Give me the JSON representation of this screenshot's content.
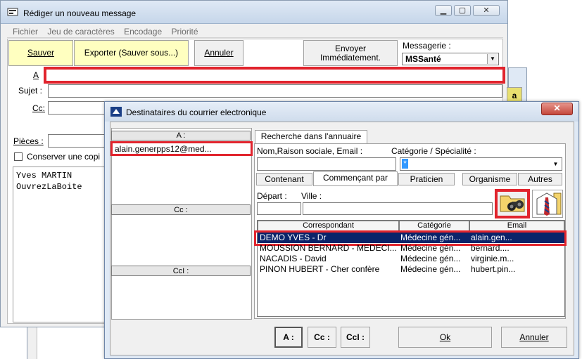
{
  "compose": {
    "title": "Rédiger un nouveau message",
    "menu": [
      "Fichier",
      "Jeu de caractères",
      "Encodage",
      "Priorité"
    ],
    "toolbar": {
      "save": "Sauver",
      "export": "Exporter (Sauver sous...)",
      "cancel": "Annuler",
      "send_line1": "Envoyer",
      "send_line2": "Immédiatement."
    },
    "messagerie_label": "Messagerie :",
    "messagerie_value": "MSSanté",
    "to_label": "A",
    "subject_label": "Sujet :",
    "cc_label": "Cc:",
    "attachments_label": "Pièces :",
    "keep_copy_label": "Conserver une copi",
    "body_lines": [
      "Yves MARTIN",
      "OuvrezLaBoite"
    ],
    "right_button": "a"
  },
  "dialog": {
    "title": "Destinataires du courrier electronique",
    "to_header": "A :",
    "to_entries": [
      "alain.generpps12@med..."
    ],
    "cc_header": "Cc :",
    "bcc_header": "CcI :",
    "tab_label": "Recherche dans l'annuaire",
    "name_label": "Nom,Raison sociale, Email :",
    "category_label": "Catégorie / Spécialité :",
    "category_value": "*",
    "filters": [
      "Contenant",
      "Commençant par",
      "Praticien",
      "Organisme",
      "Autres"
    ],
    "depart_label": "Départ :",
    "ville_label": "Ville :",
    "columns": [
      "Correspondant",
      "Catégorie",
      "Email"
    ],
    "rows": [
      {
        "name": "DEMO YVES - Dr",
        "category": "Médecine gén...",
        "email": "alain.gen..."
      },
      {
        "name": "MOUSSION BERNARD - MEDECI...",
        "category": "Médecine gén...",
        "email": "bernard...."
      },
      {
        "name": "NACADIS - David",
        "category": "Médecine gén...",
        "email": "virginie.m..."
      },
      {
        "name": "PINON HUBERT - Cher confère",
        "category": "Médecine gén...",
        "email": "hubert.pin..."
      }
    ],
    "buttons": {
      "to": "A :",
      "cc": "Cc :",
      "bcc": "CcI :",
      "ok": "Ok",
      "cancel": "Annuler"
    }
  },
  "colors": {
    "highlight": "#e1242d",
    "selection": "#0a246a",
    "yellow_button": "#ffffc0"
  }
}
